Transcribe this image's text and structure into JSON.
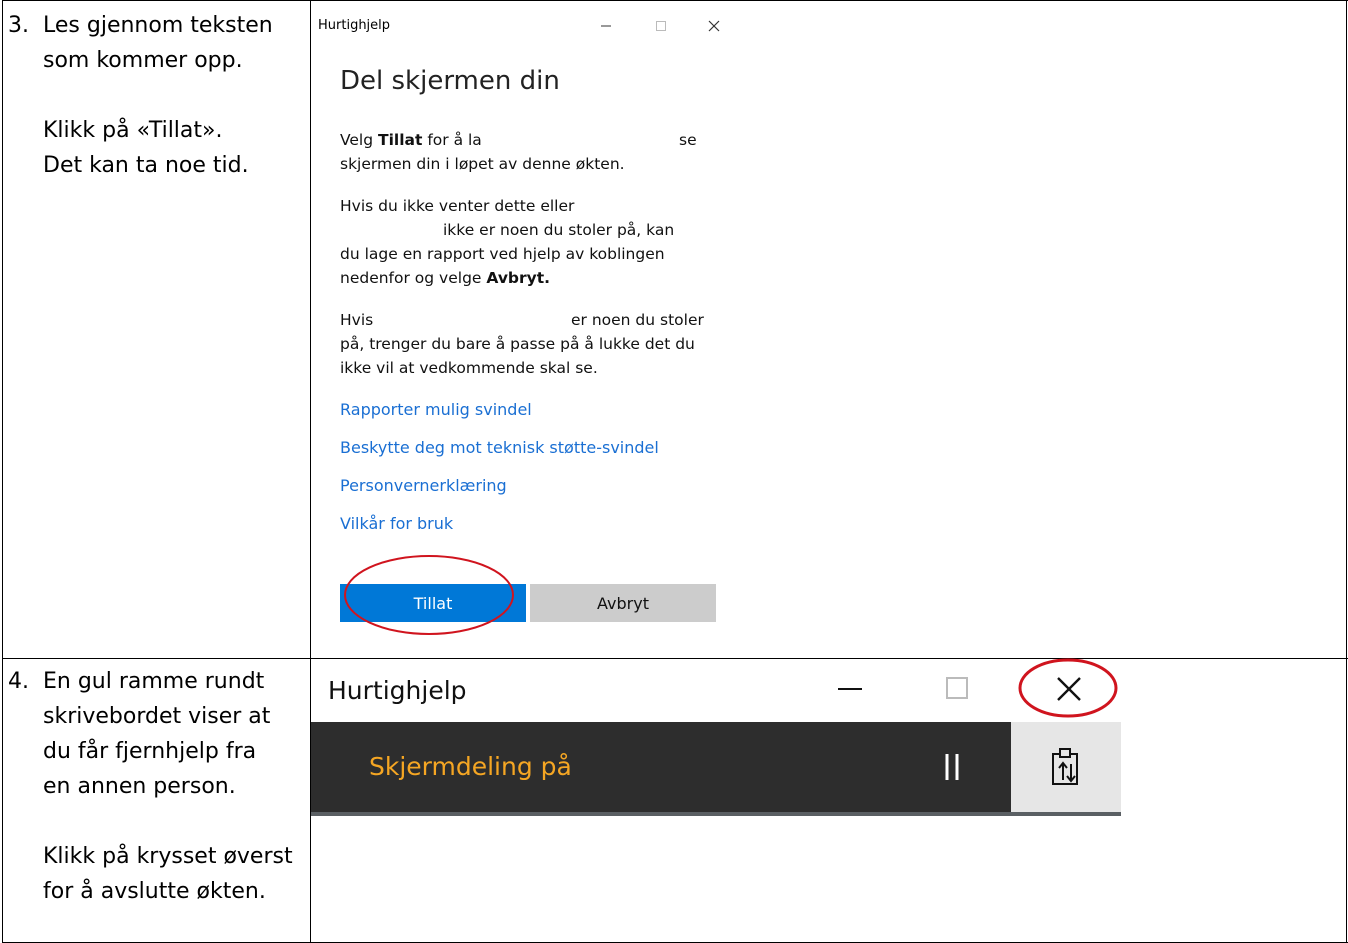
{
  "steps": [
    {
      "number": "3.",
      "lines_a": [
        "Les gjennom teksten",
        "som kommer opp."
      ],
      "lines_b": [
        "Klikk på «Tillat».",
        "Det kan ta noe tid."
      ]
    },
    {
      "number": "4.",
      "lines_a": [
        "En gul ramme rundt",
        "skrivebordet viser at",
        "du får fjernhjelp fra",
        "en annen person."
      ],
      "lines_b": [
        "Klikk på krysset øverst",
        "for å avslutte økten."
      ]
    }
  ],
  "dialog1": {
    "title": "Hurtighjelp",
    "heading": "Del skjermen din",
    "p1_prefix": "Velg ",
    "p1_bold": "Tillat",
    "p1_mid": " for å la",
    "p1_end": "se",
    "p1_line2": "skjermen din i løpet av denne økten.",
    "p2_line1": "Hvis du ikke venter dette eller",
    "p2_line2": "ikke er noen du stoler på, kan",
    "p2_line3": "du lage en rapport ved hjelp av koblingen",
    "p2_line4_prefix": "nedenfor og velge ",
    "p2_line4_bold": "Avbryt.",
    "p3_line1_prefix": "Hvis",
    "p3_line1_end": "er noen du stoler",
    "p3_line2": "på, trenger du bare å passe på å lukke det du",
    "p3_line3": "ikke vil at vedkommende skal se.",
    "links": [
      "Rapporter mulig svindel",
      "Beskytte deg mot teknisk støtte-svindel",
      "Personvernerklæring",
      "Vilkår for bruk"
    ],
    "allow_label": "Tillat",
    "cancel_label": "Avbryt"
  },
  "dialog2": {
    "title": "Hurtighjelp",
    "status": "Skjermdeling på"
  },
  "colors": {
    "link": "#1a6fd3",
    "allow_button": "#0078d7",
    "cancel_button": "#cccccc",
    "highlight_circle": "#d0141e",
    "status_text": "#f5a623",
    "dark_bar": "#2d2d2d"
  }
}
